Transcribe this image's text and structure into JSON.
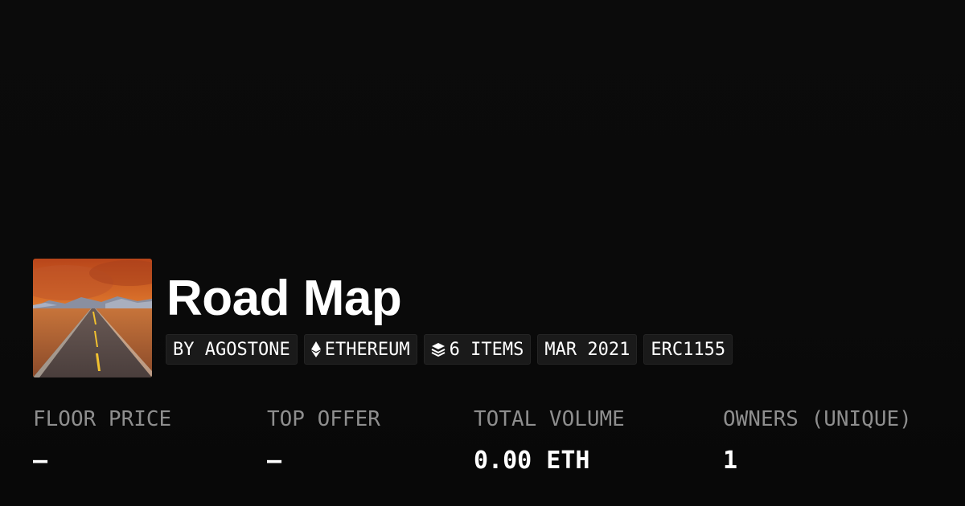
{
  "collection": {
    "title": "Road Map",
    "tags": {
      "creator": "BY AGOSTONE",
      "chain": "ETHEREUM",
      "items": "6 ITEMS",
      "date": "MAR 2021",
      "standard": "ERC1155"
    },
    "icons": {
      "chain": "ethereum-icon",
      "items": "layers-icon"
    }
  },
  "stats": {
    "floor_price": {
      "label": "FLOOR PRICE",
      "value": "—"
    },
    "top_offer": {
      "label": "TOP OFFER",
      "value": "—"
    },
    "total_volume": {
      "label": "TOTAL VOLUME",
      "value": "0.00 ETH"
    },
    "owners": {
      "label": "OWNERS (UNIQUE)",
      "value": "1"
    }
  },
  "colors": {
    "background": "#0a0a0a",
    "tag_background": "#1a1a1a",
    "label_gray": "#8e8e8e",
    "text": "#ffffff"
  }
}
